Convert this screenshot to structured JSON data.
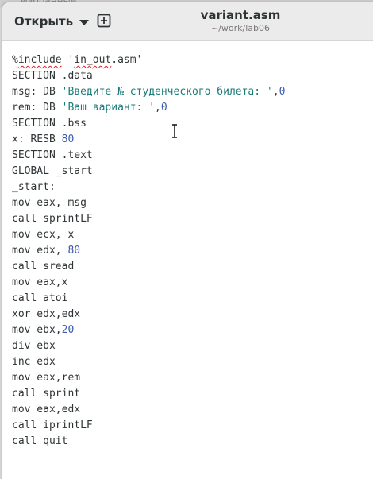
{
  "background": {
    "partial_text": "Избранные"
  },
  "header": {
    "open_label": "Открыть",
    "title": "variant.asm",
    "path": "~/work/lab06"
  },
  "editor": {
    "lines": {
      "l1": {
        "pre": "%",
        "err_a": "include",
        "mid": " '",
        "err_b": "in_out",
        "post": ".asm'"
      },
      "l2": {
        "text": "SECTION .data"
      },
      "l3": {
        "pre": "msg: DB ",
        "str": "'Введите № студенческого билета: '",
        "comma": ",",
        "num": "0"
      },
      "l4": {
        "pre": "rem: DB ",
        "str": "'Ваш вариант: '",
        "comma": ",",
        "num": "0"
      },
      "l5": {
        "text": "SECTION .bss"
      },
      "l6": {
        "pre": "x: RESB ",
        "num": "80"
      },
      "l7": {
        "text": "SECTION .text"
      },
      "l8": {
        "text": "GLOBAL _start"
      },
      "l9": {
        "text": "_start:"
      },
      "l10": {
        "text": "mov eax, msg"
      },
      "l11": {
        "text": "call sprintLF"
      },
      "l12": {
        "text": "mov ecx, x"
      },
      "l13": {
        "pre": "mov edx, ",
        "num": "80"
      },
      "l14": {
        "text": "call sread"
      },
      "l15": {
        "text": "mov eax,x"
      },
      "l16": {
        "text": "call atoi"
      },
      "l17": {
        "text": "xor edx,edx"
      },
      "l18": {
        "pre": "mov ebx,",
        "num": "20"
      },
      "l19": {
        "text": "div ebx"
      },
      "l20": {
        "text": "inc edx"
      },
      "l21": {
        "text": "mov eax,rem"
      },
      "l22": {
        "text": "call sprint"
      },
      "l23": {
        "text": "mov eax,edx"
      },
      "l24": {
        "text": "call iprintLF"
      },
      "l25": {
        "text": "call quit"
      }
    }
  },
  "colors": {
    "string": "#1b7b77",
    "number": "#3c5ab0",
    "spell_error": "#e01b24",
    "header_bg": "#ebebeb"
  },
  "icons": {
    "open_caret": "chevron-down-icon",
    "new_tab": "new-tab-icon",
    "cursor": "text-cursor-icon"
  }
}
